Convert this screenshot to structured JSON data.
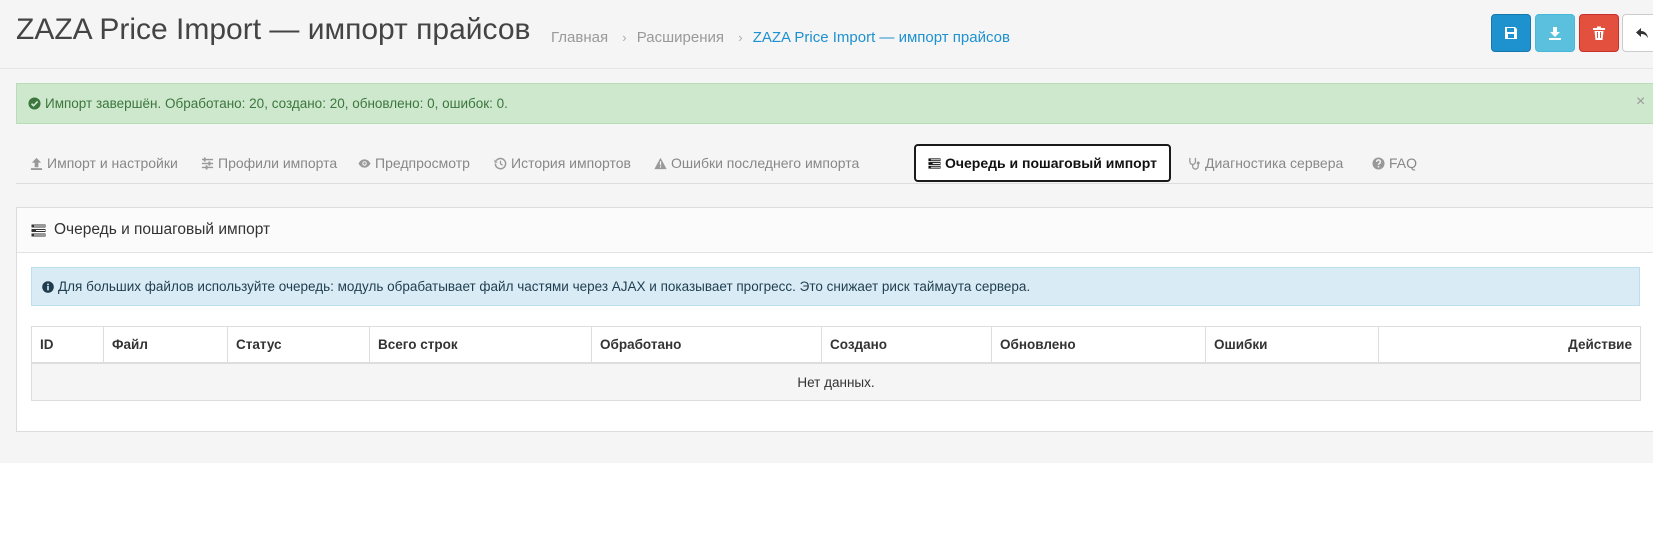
{
  "header": {
    "title": "ZAZA Price Import — импорт прайсов",
    "breadcrumb": [
      {
        "label": "Главная"
      },
      {
        "label": "Расширения"
      },
      {
        "label": "ZAZA Price Import — импорт прайсов"
      }
    ],
    "buttons": [
      {
        "icon": "save-icon",
        "color": "#1e91cf"
      },
      {
        "icon": "download-icon",
        "color": "#5bc0de"
      },
      {
        "icon": "trash-icon",
        "color": "#e3503e"
      },
      {
        "icon": "reply-icon",
        "color": "#ffffff"
      }
    ],
    "breadcrumb_separator": "›"
  },
  "alert": {
    "icon": "check-circle-icon",
    "text": "Импорт завершён. Обработано: 20, создано: 20, обновлено: 0, ошибок: 0.",
    "close": "×"
  },
  "tabs": [
    {
      "label": "Импорт и настройки",
      "icon": "upload-icon"
    },
    {
      "label": "Профили импорта",
      "icon": "sliders-icon"
    },
    {
      "label": "Предпросмотр",
      "icon": "eye-icon"
    },
    {
      "label": "История импортов",
      "icon": "history-icon"
    },
    {
      "label": "Ошибки последнего импорта",
      "icon": "warning-icon"
    },
    {
      "label": "Очередь и пошаговый импорт",
      "icon": "tasks-icon",
      "active": true
    },
    {
      "label": "Диагностика сервера",
      "icon": "stethoscope-icon"
    },
    {
      "label": "FAQ",
      "icon": "question-circle-icon"
    }
  ],
  "panel": {
    "title": "Очередь и пошаговый импорт",
    "info": "Для больших файлов используйте очередь: модуль обрабатывает файл частями через AJAX и показывает прогресс. Это снижает риск таймаута сервера.",
    "table": {
      "columns": [
        "ID",
        "Файл",
        "Статус",
        "Всего строк",
        "Обработано",
        "Создано",
        "Обновлено",
        "Ошибки",
        "Действие"
      ],
      "empty": "Нет данных."
    }
  },
  "colors": {
    "primary": "#1e91cf",
    "info": "#5bc0de",
    "danger": "#e3503e",
    "success_bg": "#cde8cc",
    "info_bg": "#d9ecf5"
  }
}
